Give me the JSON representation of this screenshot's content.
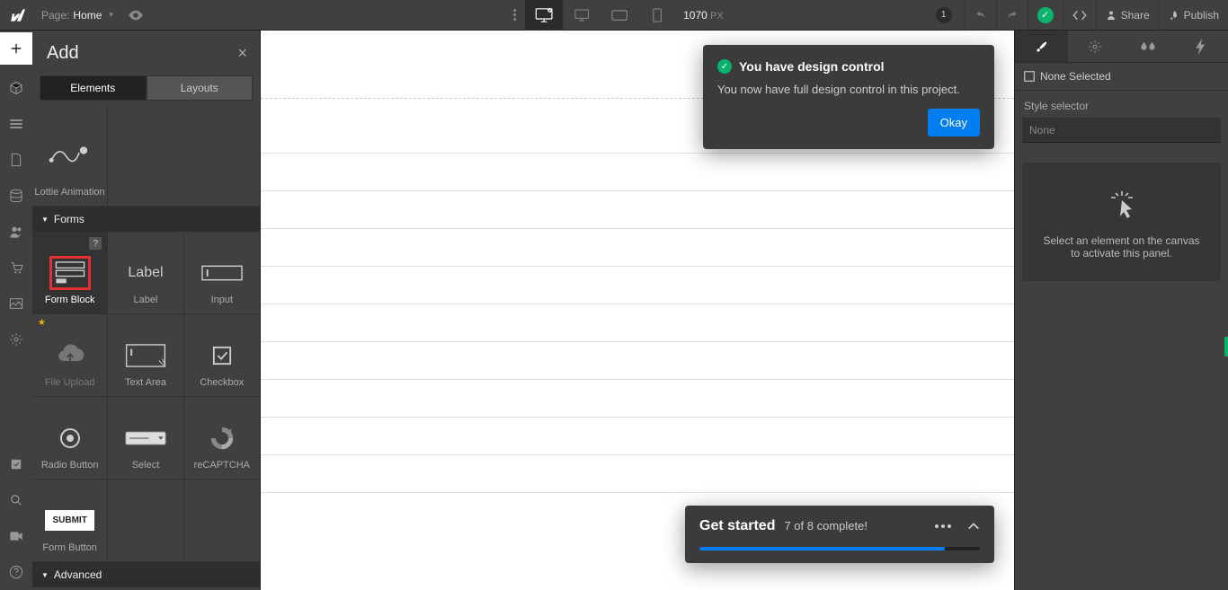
{
  "topbar": {
    "page_label": "Page:",
    "page_name": "Home",
    "px_value": "1070",
    "px_unit": "PX",
    "badge": "1",
    "share": "Share",
    "publish": "Publish"
  },
  "add_panel": {
    "title": "Add",
    "tab_elements": "Elements",
    "tab_layouts": "Layouts",
    "lottie": "Lottie Animation",
    "cat_forms": "Forms",
    "cat_advanced": "Advanced",
    "tiles": {
      "form_block": "Form Block",
      "label": "Label",
      "label_icon_text": "Label",
      "input": "Input",
      "file_upload": "File Upload",
      "text_area": "Text Area",
      "checkbox": "Checkbox",
      "radio": "Radio Button",
      "select": "Select",
      "recaptcha": "reCAPTCHA",
      "submit": "SUBMIT",
      "form_button": "Form Button"
    }
  },
  "notification": {
    "title": "You have design control",
    "body": "You now have full design control in this project.",
    "okay": "Okay"
  },
  "get_started": {
    "title": "Get started",
    "progress_text": "7 of 8 complete!",
    "progress_pct": 87.5
  },
  "right_panel": {
    "none_selected": "None Selected",
    "style_selector": "Style selector",
    "style_value": "None",
    "hint": "Select an element on the canvas to activate this panel."
  }
}
